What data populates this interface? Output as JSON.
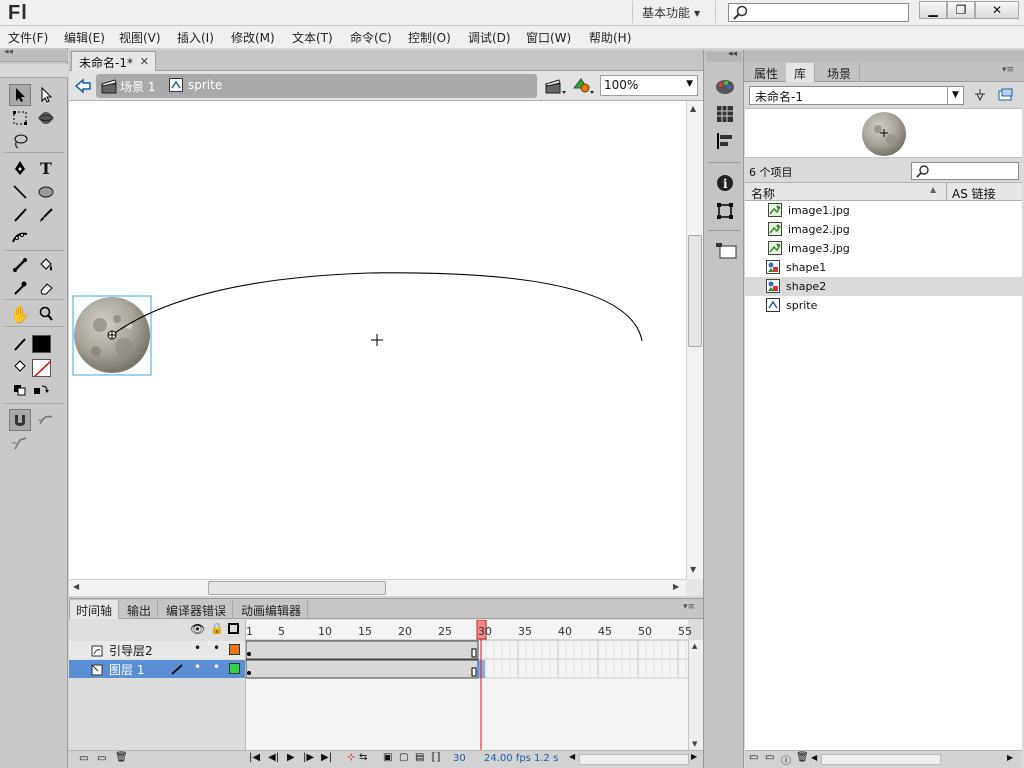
{
  "app": {
    "logo": "Fl",
    "workspace": "基本功能"
  },
  "menu": [
    "文件(F)",
    "编辑(E)",
    "视图(V)",
    "插入(I)",
    "修改(M)",
    "文本(T)",
    "命令(C)",
    "控制(O)",
    "调试(D)",
    "窗口(W)",
    "帮助(H)"
  ],
  "document": {
    "tab_title": "未命名-1*",
    "scene": "场景 1",
    "symbol": "sprite",
    "zoom": "100%"
  },
  "timeline": {
    "tabs": [
      "时间轴",
      "输出",
      "编译器错误",
      "动画编辑器"
    ],
    "frame_ticks": [
      "1",
      "5",
      "10",
      "15",
      "20",
      "25",
      "30",
      "35",
      "40",
      "45",
      "50",
      "55"
    ],
    "current_frame": "30",
    "layers": [
      {
        "name": "引导层2",
        "selected": false,
        "color": "#e87511"
      },
      {
        "name": "图层 1",
        "selected": true,
        "color": "#33d14a"
      }
    ],
    "status": {
      "frame": "30",
      "fps": "24.00 fps",
      "time": "1.2 s"
    }
  },
  "library": {
    "tabs": [
      "属性",
      "库",
      "场景"
    ],
    "document": "未命名-1",
    "count": "6 个项目",
    "col_name": "名称",
    "col_link": "AS 链接",
    "items": [
      {
        "name": "image1.jpg",
        "type": "bitmap"
      },
      {
        "name": "image2.jpg",
        "type": "bitmap"
      },
      {
        "name": "image3.jpg",
        "type": "bitmap"
      },
      {
        "name": "shape1",
        "type": "graphic"
      },
      {
        "name": "shape2",
        "type": "graphic",
        "selected": true
      },
      {
        "name": "sprite",
        "type": "movieclip"
      }
    ]
  },
  "colors": {
    "stroke": "#000000",
    "fill": "none",
    "selection": "#00a0e6"
  }
}
